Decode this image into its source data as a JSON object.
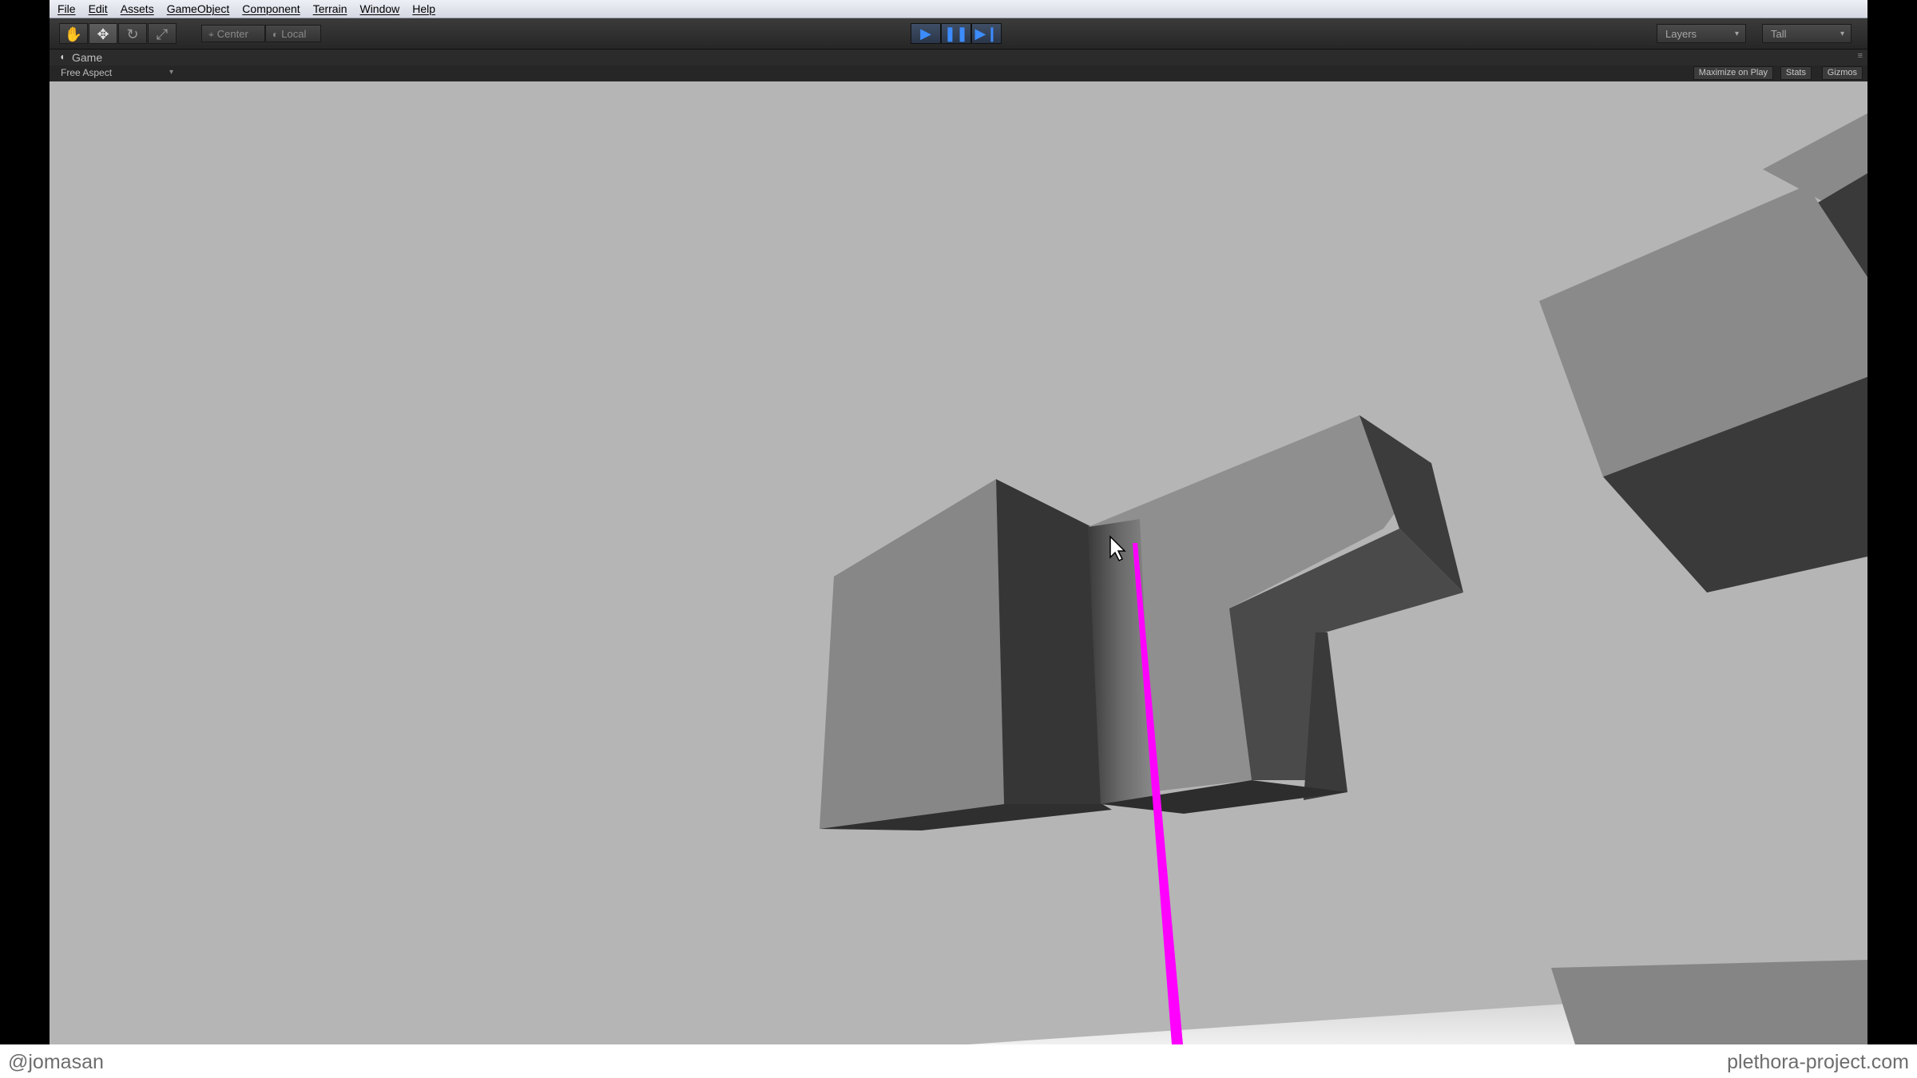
{
  "menu": [
    "File",
    "Edit",
    "Assets",
    "GameObject",
    "Component",
    "Terrain",
    "Window",
    "Help"
  ],
  "toolbar": {
    "tools": [
      {
        "name": "hand-tool-icon",
        "glyph": "✋"
      },
      {
        "name": "move-tool-icon",
        "glyph": "✥"
      },
      {
        "name": "rotate-tool-icon",
        "glyph": "↻"
      },
      {
        "name": "scale-tool-icon",
        "glyph": "⤢"
      }
    ],
    "pivot_label": "Center",
    "space_label": "Local",
    "layers_label": "Layers",
    "layout_label": "Tall"
  },
  "game_panel": {
    "tab_title": "Game",
    "aspect": "Free Aspect",
    "maximize_on_play": "Maximize on Play",
    "stats": "Stats",
    "gizmos": "Gizmos"
  },
  "colors": {
    "background": "#b4b4b4",
    "ray": "#ff00ff",
    "play_accent": "#3c8cff"
  },
  "watermarks": {
    "left": "@jomasan",
    "right": "plethora-project.com"
  }
}
